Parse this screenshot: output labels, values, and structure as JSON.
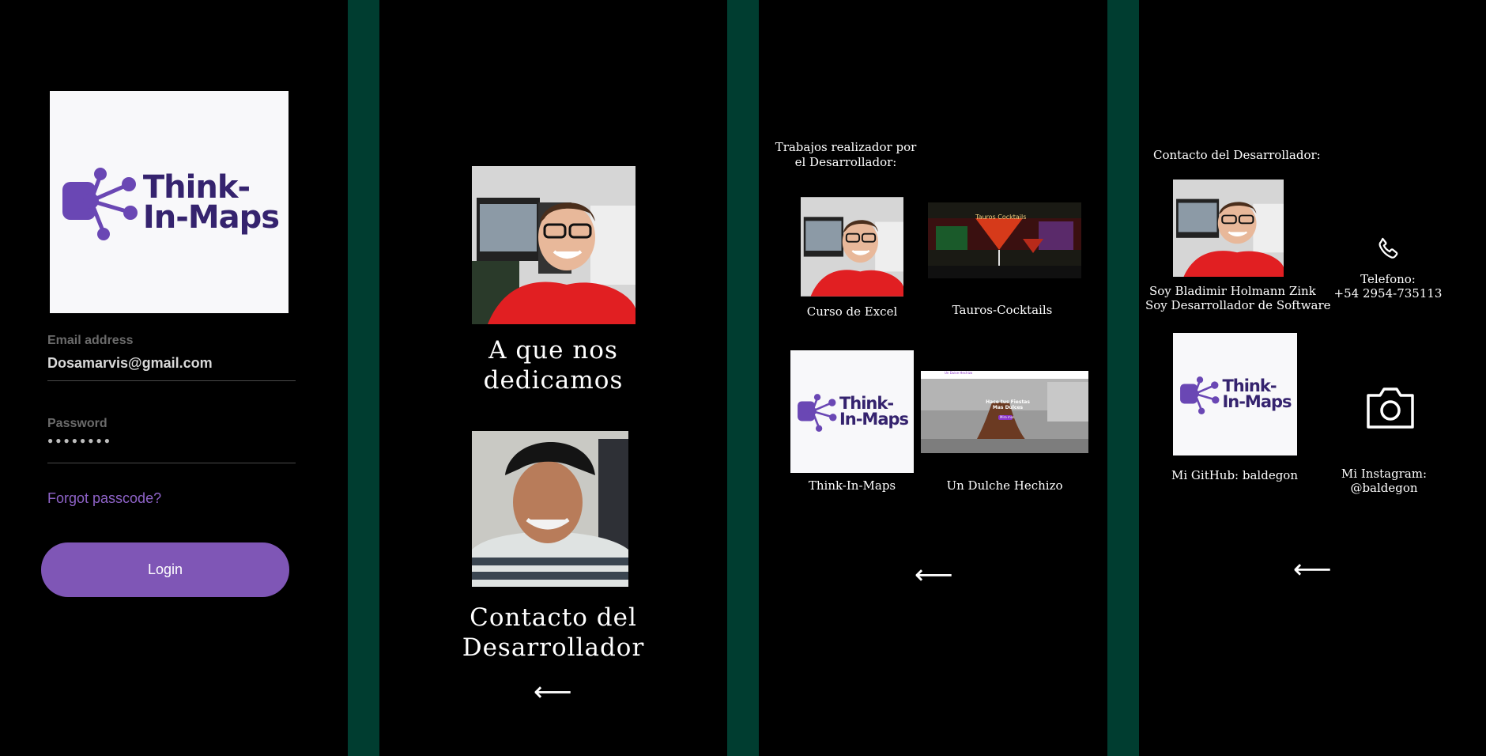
{
  "login": {
    "logo_line1": "Think-",
    "logo_line2": "In-Maps",
    "email_label": "Email address",
    "email_value": "Dosamarvis@gmail.com",
    "password_label": "Password",
    "password_value": "●●●●●●●●",
    "forgot_label": "Forgot passcode?",
    "login_label": "Login"
  },
  "menu": {
    "item1": "A que nos dedicamos",
    "item2": "Contacto del Desarrollador",
    "back_arrow": "⟵"
  },
  "works": {
    "heading": "Trabajos realizador por el Desarrollador:",
    "items": [
      {
        "label": "Curso de Excel"
      },
      {
        "label": "Tauros-Cocktails",
        "thumb_text": "Tauros Cocktails"
      },
      {
        "label": "Think-In-Maps",
        "logo_line1": "Think-",
        "logo_line2": "In-Maps"
      },
      {
        "label": "Un Dulche Hechizo",
        "thumb_text": "Hace tus Fiestas Mas Dulces",
        "thumb_brand": "Un Dulce Hechizo",
        "thumb_button": "Mira mas"
      }
    ],
    "back_arrow": "⟵"
  },
  "contact": {
    "heading": "Contacto del Desarrollador:",
    "bio_line1": "Soy Bladimir Holmann Zink",
    "bio_line2": "Soy Desarrollador de Software",
    "phone_label": "Telefono:",
    "phone_value": "+54 2954-735113",
    "github_label": "Mi GitHub: baldegon",
    "github_logo1": "Think-",
    "github_logo2": "In-Maps",
    "instagram_label": "Mi Instagram:",
    "instagram_value": "@baldegon",
    "back_arrow": "⟵"
  },
  "colors": {
    "accent": "#7f56b6",
    "separator": "#003d30",
    "logo_purple": "#35236e",
    "logo_icon": "#6a47b4"
  },
  "icons": [
    "network-logo-icon",
    "phone-icon",
    "camera-icon",
    "back-arrow-icon"
  ]
}
